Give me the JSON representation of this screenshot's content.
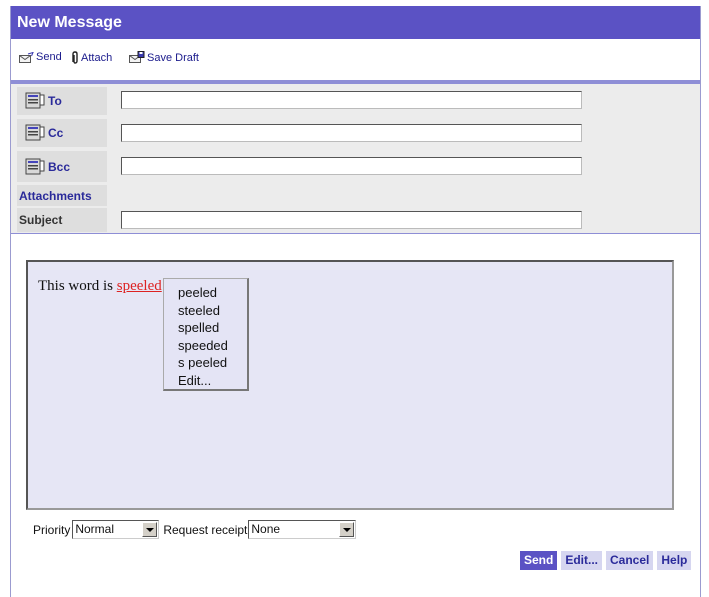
{
  "window": {
    "title": "New Message"
  },
  "toolbar": {
    "send_label": "Send",
    "attach_label": "Attach",
    "save_draft_label": "Save Draft"
  },
  "fields": {
    "to_label": "To",
    "cc_label": "Cc",
    "bcc_label": "Bcc",
    "attachments_label": "Attachments",
    "subject_label": "Subject",
    "to_value": "",
    "cc_value": "",
    "bcc_value": "",
    "subject_value": ""
  },
  "body": {
    "prefix": "This word is ",
    "misspelled_word": "speeled"
  },
  "spell_menu": {
    "items": [
      "peeled",
      "steeled",
      "spelled",
      "speeded",
      "s peeled",
      "Edit..."
    ]
  },
  "options": {
    "priority_label": "Priority",
    "priority_value": "Normal",
    "receipt_label": "Request receipt",
    "receipt_value": "None"
  },
  "buttons": {
    "send": "Send",
    "edit": "Edit...",
    "cancel": "Cancel",
    "help": "Help"
  },
  "icons": {
    "send": "send-envelope-icon",
    "attach": "paperclip-icon",
    "save_draft": "save-draft-icon",
    "address_book": "address-book-icon"
  },
  "colors": {
    "title_bar": "#5b52c4",
    "misspelled": "#d22222",
    "field_background": "#ececec",
    "body_background": "#e6e6f5"
  }
}
